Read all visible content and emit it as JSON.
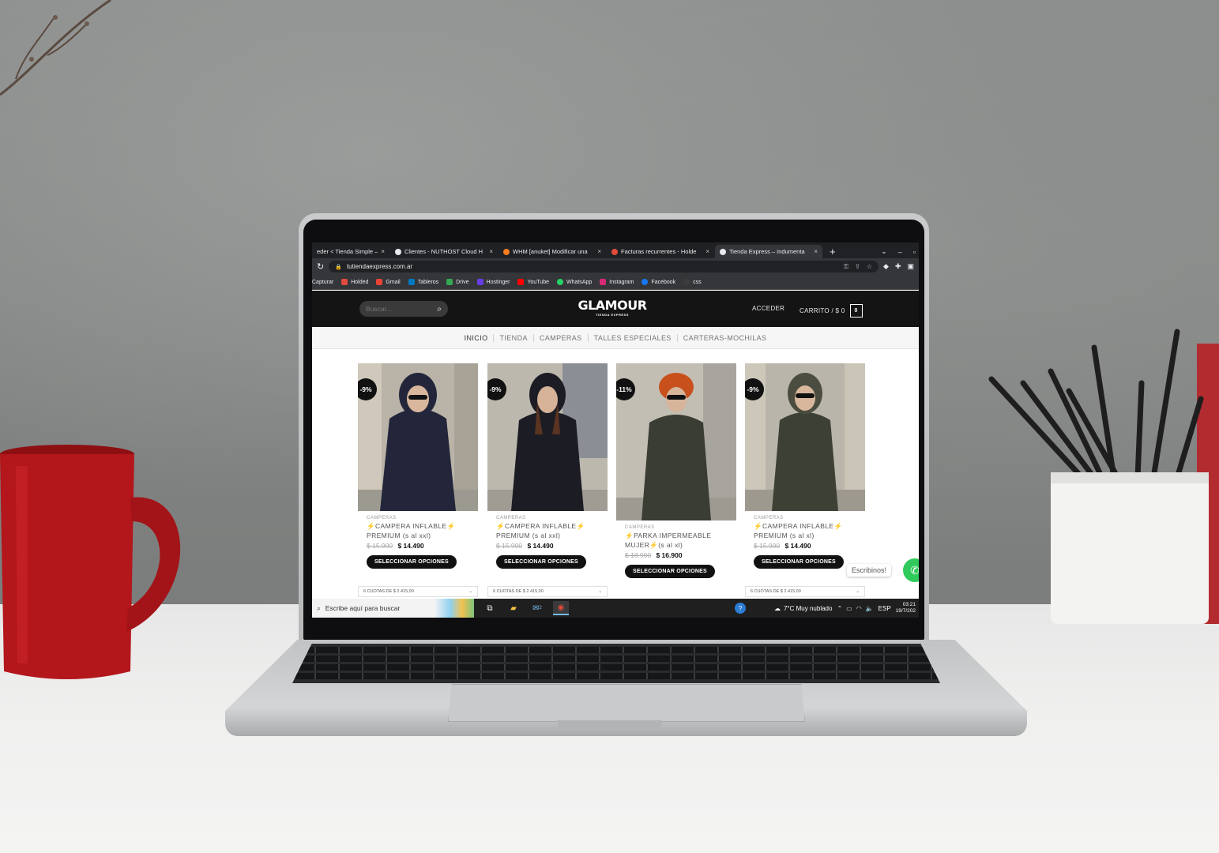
{
  "browser": {
    "tabs": [
      {
        "title": "eder < Tienda Simple —",
        "icon_color": "#9aa0a6",
        "active": false
      },
      {
        "title": "Clientes - NUTHOST Cloud H",
        "icon_color": "#e8eaed",
        "active": false
      },
      {
        "title": "WHM [anuket] Modificar una",
        "icon_color": "#f57c20",
        "active": false
      },
      {
        "title": "Facturas recurrentes - Holde",
        "icon_color": "#e24b3b",
        "active": false
      },
      {
        "title": "Tienda Express – Indumenta",
        "icon_color": "#e8eaed",
        "active": true
      }
    ],
    "close_glyph": "×",
    "new_tab_glyph": "+",
    "url": "tutiendaexpress.com.ar",
    "bookmarks": [
      {
        "label": "Capturar",
        "color": "#35363a"
      },
      {
        "label": "Holded",
        "color": "#e24b3b"
      },
      {
        "label": "Gmail",
        "color": "#ea4335"
      },
      {
        "label": "Tableros",
        "color": "#0079bf"
      },
      {
        "label": "Drive",
        "color": "#34a853"
      },
      {
        "label": "Hostinger",
        "color": "#673de6"
      },
      {
        "label": "YouTube",
        "color": "#ff0000"
      },
      {
        "label": "WhatsApp",
        "color": "#25d366"
      },
      {
        "label": "Instagram",
        "color": "#d62976"
      },
      {
        "label": "Facebook",
        "color": "#1877f2"
      },
      {
        "label": "css",
        "color": "#3c3c3c"
      }
    ]
  },
  "site": {
    "search_placeholder": "Buscar...",
    "logo": "GLAMOUR",
    "logo_sub": "TIENDA EXPRESS",
    "account_label": "ACCEDER",
    "cart_label": "CARRITO / $ 0",
    "cart_count": "0",
    "nav": [
      "INICIO",
      "TIENDA",
      "CAMPERAS",
      "TALLES ESPECIALES",
      "CARTERAS-MOCHILAS"
    ],
    "products": [
      {
        "badge": "-9%",
        "category": "CAMPERAS",
        "name_line1": "⚡CAMPERA INFLABLE⚡",
        "name_line2": "PREMIUM (s al xxl)",
        "old_price": "$ 15.900",
        "price": "$ 14.490",
        "button": "SELECCIONAR OPCIONES",
        "cuotas": "6 CUOTAS DE $ 2.415,00",
        "jacket_color": "#23263a"
      },
      {
        "badge": "-9%",
        "category": "CAMPERAS",
        "name_line1": "⚡CAMPERA INFLABLE⚡",
        "name_line2": "PREMIUM (s al xxl)",
        "old_price": "$ 15.900",
        "price": "$ 14.490",
        "button": "SELECCIONAR OPCIONES",
        "cuotas": "6 CUOTAS DE $ 2.415,00",
        "jacket_color": "#1b1c24"
      },
      {
        "badge": "-11%",
        "category": "CAMPERAS",
        "name_line1": "⚡PARKA IMPERMEABLE",
        "name_line2": "MUJER⚡(s al xl)",
        "old_price": "$ 18.900",
        "price": "$ 16.900",
        "button": "SELECCIONAR OPCIONES",
        "cuotas": "",
        "jacket_color": "#3a3d33"
      },
      {
        "badge": "-9%",
        "category": "CAMPERAS",
        "name_line1": "⚡CAMPERA INFLABLE⚡",
        "name_line2": "PREMIUM (s al xl)",
        "old_price": "$ 15.900",
        "price": "$ 14.490",
        "button": "SELECCIONAR OPCIONES",
        "cuotas": "6 CUOTAS DE $ 2.415,00",
        "jacket_color": "#3d4034"
      }
    ],
    "whatsapp_label": "Escribinos!"
  },
  "taskbar": {
    "search_placeholder": "Escribe aquí para buscar",
    "mail_badge": "2",
    "weather": "7°C  Muy nublado",
    "lang": "ESP",
    "time": "03:21",
    "date": "19/7/202"
  }
}
